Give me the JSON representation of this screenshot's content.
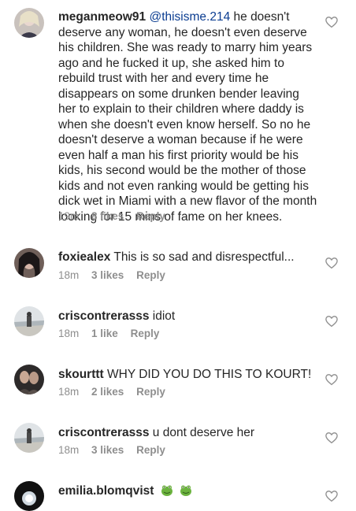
{
  "comments": [
    {
      "username": "meganmeow91",
      "mention": "@thisisme.214",
      "text": "he doesn't deserve any woman, he doesn't even deserve his children. She was ready to marry him years ago and he fucked it up, she asked him to rebuild trust with her and every time he disappears on some drunken bender leaving her to explain to their children where daddy is when she doesn't even know herself. So no he doesn't deserve a woman because if he were even half a man his first priority would be his kids, his second would be the mother of those kids and not even ranking would be getting his dick wet in Miami with a new flavor of the month looking for 15 mins of fame on her knees.",
      "time": "19m",
      "likes": "8 likes",
      "reply": "Reply"
    },
    {
      "username": "foxiealex",
      "text": "This is so sad and disrespectful...",
      "time": "18m",
      "likes": "3 likes",
      "reply": "Reply"
    },
    {
      "username": "criscontrerasss",
      "text": "idiot",
      "time": "18m",
      "likes": "1 like",
      "reply": "Reply"
    },
    {
      "username": "skourttt",
      "text": "WHY DID YOU DO THIS TO KOURT!",
      "time": "18m",
      "likes": "2 likes",
      "reply": "Reply"
    },
    {
      "username": "criscontrerasss",
      "text": "u dont deserve her",
      "time": "18m",
      "likes": "3 likes",
      "reply": "Reply"
    },
    {
      "username": "emilia.blomqvist",
      "emoji": [
        "frog-emoji",
        "frog-emoji"
      ]
    }
  ],
  "icons": {
    "like": "heart-outline-icon"
  },
  "colors": {
    "text": "#262626",
    "meta": "#8e8e8e",
    "mention": "#0b3d91"
  }
}
